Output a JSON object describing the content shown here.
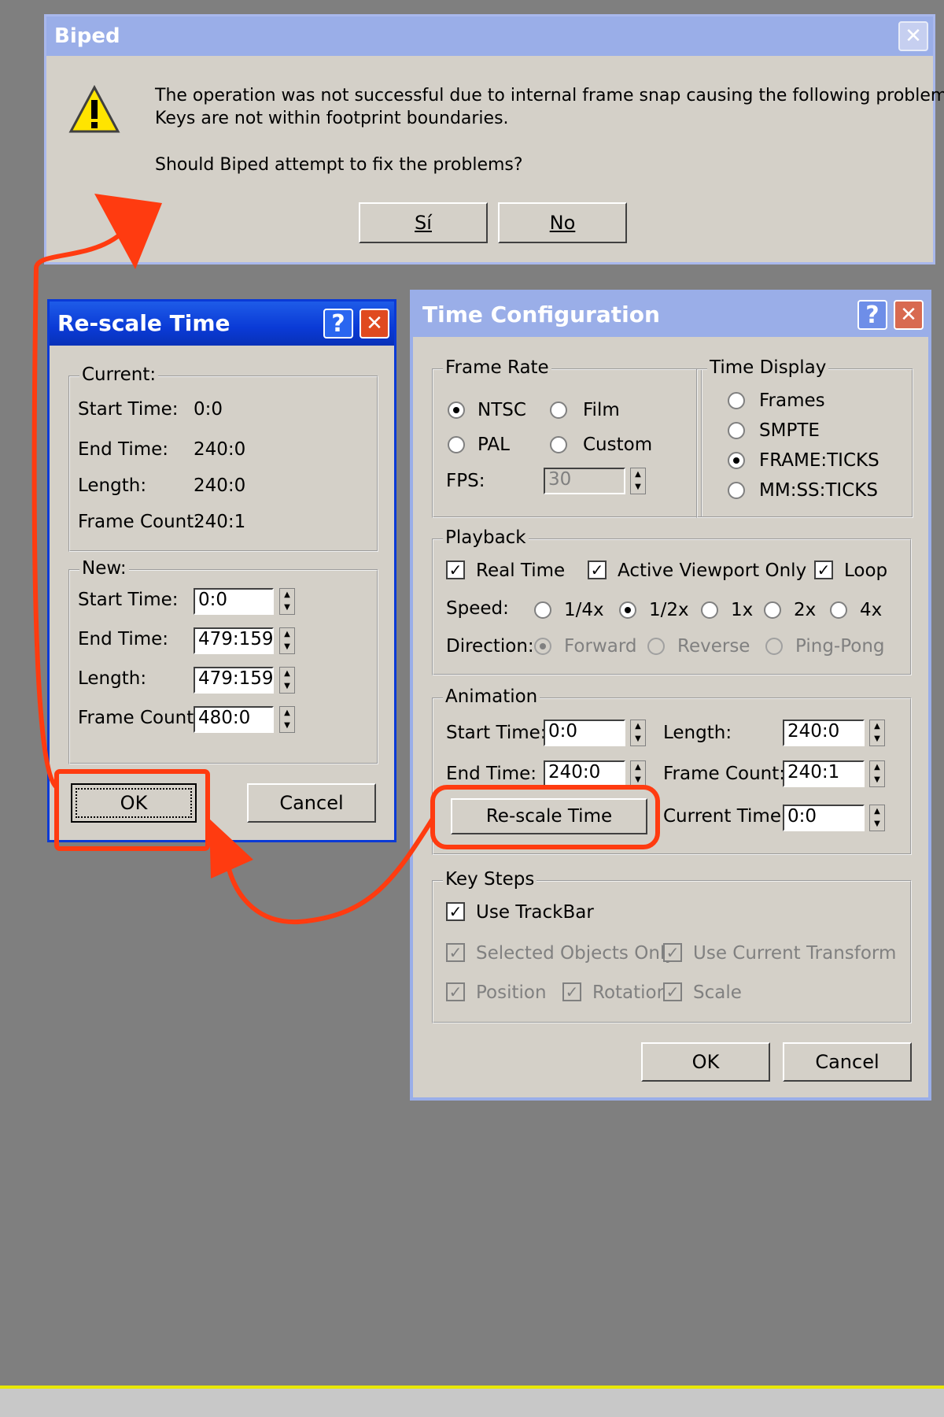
{
  "biped_dialog": {
    "title": "Biped",
    "message_line1": "The operation was not successful due to internal frame snap causing the following problems:",
    "message_line2": "Keys are not within footprint boundaries.",
    "question": "Should Biped attempt to fix the problems?",
    "yes_label": "Sí",
    "no_label": "No",
    "close_glyph": "✕"
  },
  "rescale_dialog": {
    "title": "Re-scale Time",
    "help_glyph": "?",
    "close_glyph": "✕",
    "current": {
      "legend": "Current:",
      "start_label": "Start Time:",
      "start_value": "0:0",
      "end_label": "End Time:",
      "end_value": "240:0",
      "length_label": "Length:",
      "length_value": "240:0",
      "count_label": "Frame Count:",
      "count_value": "240:1"
    },
    "new": {
      "legend": "New:",
      "start_label": "Start Time:",
      "start_value": "0:0",
      "end_label": "End Time:",
      "end_value": "479:159",
      "length_label": "Length:",
      "length_value": "479:159",
      "count_label": "Frame Count:",
      "count_value": "480:0"
    },
    "ok_label": "OK",
    "cancel_label": "Cancel"
  },
  "time_config": {
    "title": "Time Configuration",
    "help_glyph": "?",
    "close_glyph": "✕",
    "frame_rate": {
      "legend": "Frame Rate",
      "options": [
        "NTSC",
        "Film",
        "PAL",
        "Custom"
      ],
      "selected": "NTSC",
      "fps_label": "FPS:",
      "fps_value": "30"
    },
    "time_display": {
      "legend": "Time Display",
      "options": [
        "Frames",
        "SMPTE",
        "FRAME:TICKS",
        "MM:SS:TICKS"
      ],
      "selected": "FRAME:TICKS"
    },
    "playback": {
      "legend": "Playback",
      "real_time": "Real Time",
      "active_viewport": "Active Viewport Only",
      "loop": "Loop",
      "speed_label": "Speed:",
      "speeds": [
        "1/4x",
        "1/2x",
        "1x",
        "2x",
        "4x"
      ],
      "speed_selected": "1/2x",
      "direction_label": "Direction:",
      "directions": [
        "Forward",
        "Reverse",
        "Ping-Pong"
      ],
      "direction_selected": "Forward"
    },
    "animation": {
      "legend": "Animation",
      "start_label": "Start Time:",
      "start_value": "0:0",
      "end_label": "End Time:",
      "end_value": "240:0",
      "length_label": "Length:",
      "length_value": "240:0",
      "count_label": "Frame Count:",
      "count_value": "240:1",
      "current_label": "Current Time:",
      "current_value": "0:0",
      "rescale_label": "Re-scale Time"
    },
    "key_steps": {
      "legend": "Key Steps",
      "use_trackbar": "Use TrackBar",
      "selected_only": "Selected Objects Only",
      "use_current_transform": "Use Current Transform",
      "position": "Position",
      "rotation": "Rotation",
      "scale": "Scale"
    },
    "ok_label": "OK",
    "cancel_label": "Cancel"
  },
  "colors": {
    "annotation": "#ff3b10",
    "titlebar_active": "#0a3ad6",
    "titlebar_inactive": "#9aaee8",
    "yellow_line": "#e8e800"
  }
}
